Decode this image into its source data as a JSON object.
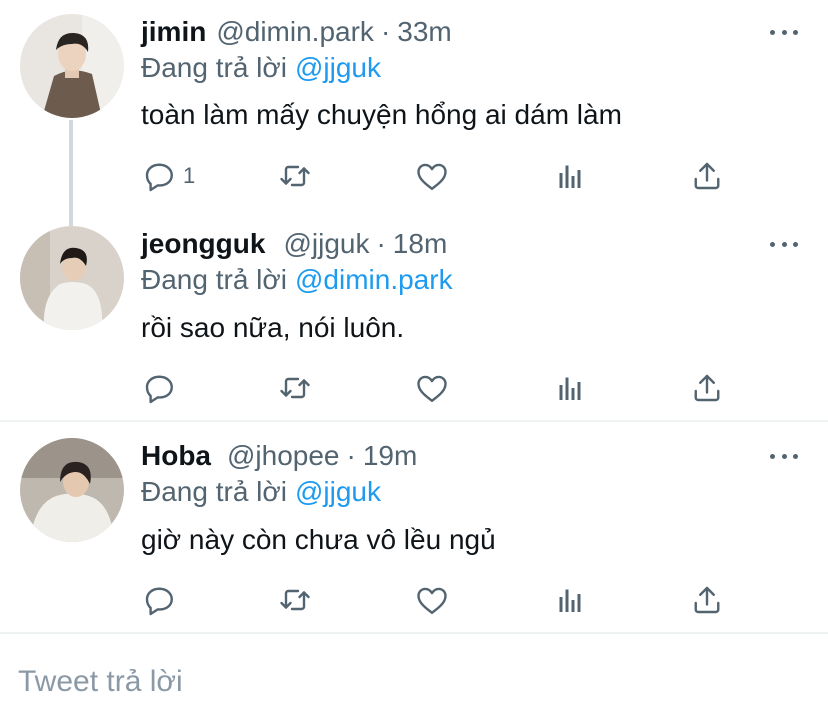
{
  "tweets": [
    {
      "name": "jimin",
      "handle": "@dimin.park",
      "separator": "·",
      "time": "33m",
      "reply_prefix": "Đang trả lời",
      "reply_to": "@jjguk",
      "text": "toàn làm mấy chuyện hổng ai dám làm",
      "reply_count": "1"
    },
    {
      "name": "jeongguk",
      "handle": "@jjguk",
      "separator": "·",
      "time": "18m",
      "reply_prefix": "Đang trả lời",
      "reply_to": "@dimin.park",
      "text": "rồi sao nữa, nói luôn.",
      "reply_count": ""
    },
    {
      "name": "Hoba",
      "handle": "@jhopee",
      "separator": "·",
      "time": "19m",
      "reply_prefix": "Đang trả lời",
      "reply_to": "@jjguk",
      "text": "giờ này còn chưa vô lều ngủ",
      "reply_count": ""
    }
  ],
  "composer": {
    "placeholder": "Tweet trả lời"
  },
  "icons": {
    "reply": "reply-icon",
    "retweet": "retweet-icon",
    "like": "heart-icon",
    "views": "analytics-icon",
    "share": "share-icon",
    "more": "more-icon"
  },
  "colors": {
    "accent": "#1d9bf0",
    "secondary_text": "#536471",
    "icon": "#536471",
    "thread_line": "#cfd9de",
    "divider": "#eff3f4"
  }
}
